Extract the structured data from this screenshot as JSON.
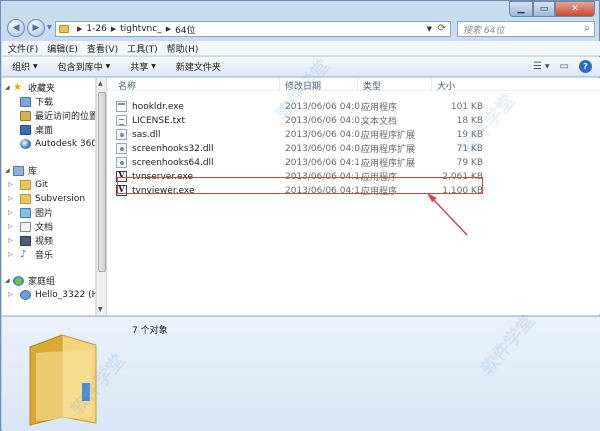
{
  "address": {
    "crumbs": [
      "1-26",
      "tightvnc_",
      "64位"
    ],
    "search_placeholder": "搜索 64位"
  },
  "menu": [
    "文件(F)",
    "编辑(E)",
    "查看(V)",
    "工具(T)",
    "帮助(H)"
  ],
  "toolbar": {
    "organize": "组织",
    "include_in_library": "包含到库中",
    "share": "共享",
    "new_folder": "新建文件夹"
  },
  "nav": {
    "favorites": "收藏夹",
    "downloads": "下载",
    "recent": "最近访问的位置",
    "desktop": "桌面",
    "autodesk": "Autodesk 360",
    "libraries": "库",
    "git": "Git",
    "subversion": "Subversion",
    "pictures": "图片",
    "documents": "文档",
    "videos": "视频",
    "music": "音乐",
    "homegroup": "家庭组",
    "user": "Hello_3322 (HEL"
  },
  "columns": {
    "name": "名称",
    "date": "修改日期",
    "type": "类型",
    "size": "大小"
  },
  "files": [
    {
      "name": "hookldr.exe",
      "date": "2013/06/06 04:0...",
      "type": "应用程序",
      "size": "101 KB",
      "icon": "exe"
    },
    {
      "name": "LICENSE.txt",
      "date": "2013/06/06 04:0...",
      "type": "文本文档",
      "size": "18 KB",
      "icon": "txt"
    },
    {
      "name": "sas.dll",
      "date": "2013/06/06 04:0...",
      "type": "应用程序扩展",
      "size": "19 KB",
      "icon": "dll"
    },
    {
      "name": "screenhooks32.dll",
      "date": "2013/06/06 04:0...",
      "type": "应用程序扩展",
      "size": "71 KB",
      "icon": "dll"
    },
    {
      "name": "screenhooks64.dll",
      "date": "2013/06/06 04:1...",
      "type": "应用程序扩展",
      "size": "79 KB",
      "icon": "dll"
    },
    {
      "name": "tvnserver.exe",
      "date": "2013/06/06 04:1...",
      "type": "应用程序",
      "size": "2,061 KB",
      "icon": "vnc"
    },
    {
      "name": "tvnviewer.exe",
      "date": "2013/06/06 04:1...",
      "type": "应用程序",
      "size": "1,100 KB",
      "icon": "vnc"
    }
  ],
  "details": {
    "item_count": "7 个对象"
  },
  "watermark": "软件学堂",
  "colors": {
    "highlight": "#d0434f",
    "folder": "#e9c65d"
  }
}
